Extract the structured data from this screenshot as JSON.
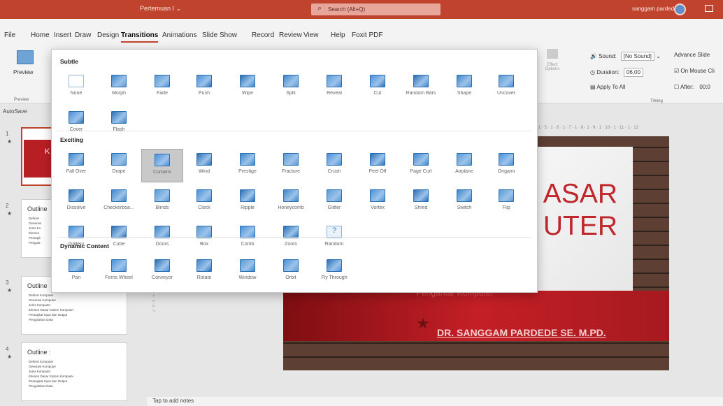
{
  "window": {
    "doc_title": "Pertemuan I",
    "search_placeholder": "Search (Alt+Q)",
    "user_name": "sanggam pardede"
  },
  "menu": [
    "File",
    "Home",
    "Insert",
    "Draw",
    "Design",
    "Transitions",
    "Animations",
    "Slide Show",
    "Record",
    "Review",
    "View",
    "Help",
    "Foxit PDF"
  ],
  "ribbon": {
    "preview_label": "Preview",
    "preview_group": "Preview",
    "effect_options": "Effect Options",
    "sound_label": "Sound:",
    "sound_value": "[No Sound]",
    "advance_label": "Advance Slide",
    "duration_label": "Duration:",
    "duration_value": "06,00",
    "on_mouse_click": "On Mouse Cli",
    "apply_to_all": "Apply To All",
    "after_label": "After:",
    "after_value": "00:0",
    "timing_group": "Timing"
  },
  "autosave": "AutoSave",
  "ruler_text": "1 · 5 · 1 · 6 · 1 · 7 · 1 · 8 · 1 · 9 · 1 · 10 · 1 · 11 · 1 · 12 ·",
  "vruler_text": "2 · 1 · 3 · 4 · 5 · 6 · 7",
  "gallery": {
    "sections": [
      {
        "title": "Subtle",
        "items": [
          "None",
          "Morph",
          "Fade",
          "Push",
          "Wipe",
          "Split",
          "Reveal",
          "Cut",
          "Random Bars",
          "Shape",
          "Uncover",
          "Cover",
          "Flash"
        ]
      },
      {
        "title": "Exciting",
        "items": [
          "Fall Over",
          "Drape",
          "Curtains",
          "Wind",
          "Prestige",
          "Fracture",
          "Crush",
          "Peel Off",
          "Page Curl",
          "Airplane",
          "Origami",
          "Dissolve",
          "Checkerboa...",
          "Blinds",
          "Clock",
          "Ripple",
          "Honeycomb",
          "Glitter",
          "Vortex",
          "Shred",
          "Switch",
          "Flip",
          "Gallery",
          "Cube",
          "Doors",
          "Box",
          "Comb",
          "Zoom",
          "Random"
        ]
      },
      {
        "title": "Dynamic Content",
        "items": [
          "Pan",
          "Ferris Wheel",
          "Conveyor",
          "Rotate",
          "Window",
          "Orbit",
          "Fly Through"
        ]
      }
    ],
    "selected": "Curtains"
  },
  "slides": [
    {
      "num": "1",
      "title": "K"
    },
    {
      "num": "2",
      "title": "Outline",
      "lines": [
        "Definisi",
        "Generasi",
        "Jenis Ko",
        "Elemen",
        "Perangk",
        "Pengola"
      ]
    },
    {
      "num": "3",
      "title": "Outline",
      "lines": [
        "Definisi Komputer",
        "Generasi Komputer",
        "Jenis Komputer",
        "Elemen Dasar Sistem Komputer",
        "Perangkat Input dan Output",
        "Pengolahan Data"
      ]
    },
    {
      "num": "4",
      "title": "Outline :",
      "lines": [
        "Definisi Komputer",
        "Generasi Komputer",
        "Jenis Komputer",
        "Elemen Dasar Sistem Komputer",
        "Perangkat Input dan Output",
        "Pengolahan Data"
      ]
    }
  ],
  "slide_main": {
    "title": "ASAR\nUTER",
    "subtitle": "Pengantar Komputer",
    "author": "DR. SANGGAM PARDEDE SE. M.PD."
  },
  "notes": "Tap to add notes",
  "colors": {
    "accent": "#c0442d",
    "icon_blue": "#3f86c9",
    "slide_red": "#c41f26"
  }
}
